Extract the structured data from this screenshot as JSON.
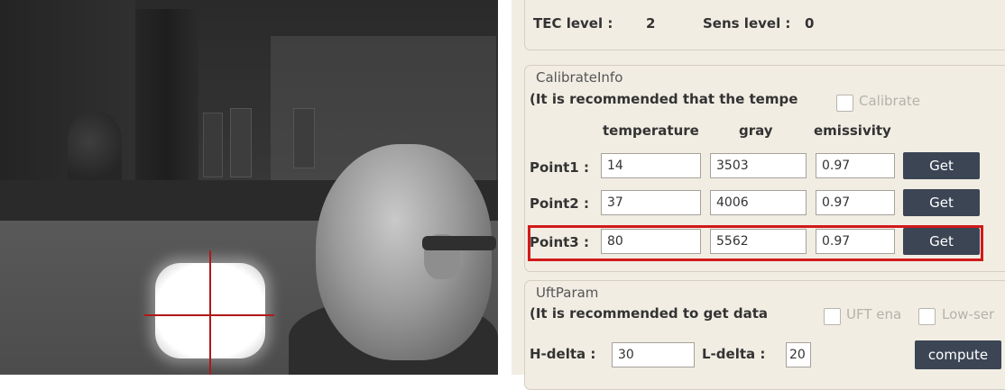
{
  "levels": {
    "tec_label": "TEC level :",
    "tec_value": "2",
    "sens_label": "Sens level :",
    "sens_value": "0"
  },
  "calibrate": {
    "title": "CalibrateInfo",
    "note": "(It is recommended that the tempe",
    "checkbox_label": "Calibrate",
    "checkbox_checked": false,
    "columns": [
      "temperature",
      "gray",
      "emissivity"
    ],
    "points": [
      {
        "label": "Point1 :",
        "temperature": "14",
        "gray": "3503",
        "emissivity": "0.97",
        "button": "Get"
      },
      {
        "label": "Point2 :",
        "temperature": "37",
        "gray": "4006",
        "emissivity": "0.97",
        "button": "Get"
      },
      {
        "label": "Point3 :",
        "temperature": "80",
        "gray": "5562",
        "emissivity": "0.97",
        "button": "Get"
      }
    ],
    "highlight_color": "#d11a1a"
  },
  "uft": {
    "title": "UftParam",
    "note": "(It is recommended to get data",
    "uft_checkbox_label": "UFT ena",
    "low_checkbox_label": "Low-ser",
    "h_delta_label": "H-delta :",
    "h_delta_value": "30",
    "l_delta_label": "L-delta :",
    "l_delta_value": "20",
    "compute_label": "compute"
  },
  "colors": {
    "panel_bg": "#f1ede3",
    "button_bg": "#3b4554",
    "crosshair": "#b01818"
  }
}
